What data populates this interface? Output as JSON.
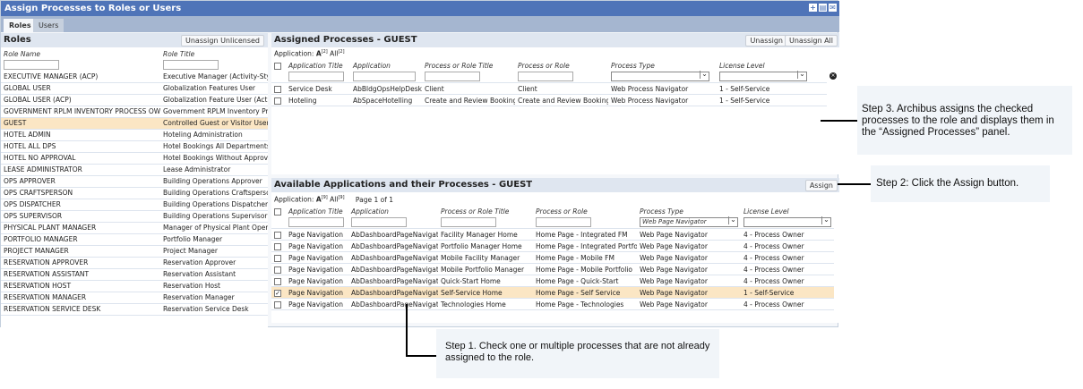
{
  "title": "Assign Processes to Roles or Users",
  "title_icons": [
    "add-icon",
    "print-icon",
    "email-icon"
  ],
  "tabs": [
    {
      "label": "Roles",
      "active": true
    },
    {
      "label": "Users",
      "active": false
    }
  ],
  "roles": {
    "title": "Roles",
    "unassign_unlicensed": "Unassign Unlicensed",
    "columns": [
      "Role Name",
      "Role Title"
    ],
    "rows": [
      [
        "EXECUTIVE MANAGER (ACP)",
        "Executive Manager (Activity-Style"
      ],
      [
        "GLOBAL USER",
        "Globalization Features User"
      ],
      [
        "GLOBAL USER (ACP)",
        "Globalization Feature User (Activit"
      ],
      [
        "GOVERNMENT RPLM INVENTORY PROCESS OWNER",
        "Government RPLM Inventory Proce"
      ],
      [
        "GUEST",
        "Controlled Guest or Visitor Users"
      ],
      [
        "HOTEL ADMIN",
        "Hoteling Administration"
      ],
      [
        "HOTEL ALL DPS",
        "Hotel Bookings All Departments"
      ],
      [
        "HOTEL NO APPROVAL",
        "Hotel Bookings Without Approval"
      ],
      [
        "LEASE ADMINISTRATOR",
        "Lease Administrator"
      ],
      [
        "OPS APPROVER",
        "Building Operations Approver"
      ],
      [
        "OPS CRAFTSPERSON",
        "Building Operations Craftsperson"
      ],
      [
        "OPS DISPATCHER",
        "Building Operations Dispatcher"
      ],
      [
        "OPS SUPERVISOR",
        "Building Operations Supervisor"
      ],
      [
        "PHYSICAL PLANT MANAGER",
        "Manager of Physical Plant Operati"
      ],
      [
        "PORTFOLIO MANAGER",
        "Portfolio Manager"
      ],
      [
        "PROJECT MANAGER",
        "Project Manager"
      ],
      [
        "RESERVATION APPROVER",
        "Reservation Approver"
      ],
      [
        "RESERVATION ASSISTANT",
        "Reservation Assistant"
      ],
      [
        "RESERVATION HOST",
        "Reservation Host"
      ],
      [
        "RESERVATION MANAGER",
        "Reservation Manager"
      ],
      [
        "RESERVATION SERVICE DESK",
        "Reservation Service Desk"
      ]
    ],
    "selected_index": 4
  },
  "assigned": {
    "title": "Assigned Processes - GUEST",
    "unassign": "Unassign",
    "unassign_all": "Unassign All",
    "app_label": "Application:",
    "filter_a": "A",
    "filter_a_count": "[2]",
    "filter_all": "All",
    "filter_all_count": "[2]",
    "columns": [
      "Application Title",
      "Application",
      "Process or Role Title",
      "Process or Role",
      "Process Type",
      "License Level"
    ],
    "rows": [
      [
        "Service Desk",
        "AbBldgOpsHelpDesk",
        "Client",
        "Client",
        "Web Process Navigator",
        "1 - Self-Service"
      ],
      [
        "Hoteling",
        "AbSpaceHotelling",
        "Create and Review Bookings",
        "Create and Review Bookings",
        "Web Process Navigator",
        "1 - Self-Service"
      ]
    ]
  },
  "available": {
    "title": "Available Applications and their Processes - GUEST",
    "assign": "Assign",
    "app_label": "Application:",
    "filter_a": "A",
    "filter_a_count": "[9]",
    "filter_all": "All",
    "filter_all_count": "[9]",
    "page": "Page 1 of 1",
    "columns": [
      "Application Title",
      "Application",
      "Process or Role Title",
      "Process or Role",
      "Process Type",
      "License Level"
    ],
    "process_type_filter": "Web Page Navigator",
    "rows": [
      {
        "cells": [
          "Page Navigation",
          "AbDashboardPageNavigation",
          "Facility Manager Home",
          "Home Page - Integrated FM",
          "Web Page Navigator",
          "4 - Process Owner"
        ],
        "checked": false
      },
      {
        "cells": [
          "Page Navigation",
          "AbDashboardPageNavigation",
          "Portfolio Manager Home",
          "Home Page - Integrated Portfolio",
          "Web Page Navigator",
          "4 - Process Owner"
        ],
        "checked": false
      },
      {
        "cells": [
          "Page Navigation",
          "AbDashboardPageNavigation",
          "Mobile Facility Manager",
          "Home Page - Mobile FM",
          "Web Page Navigator",
          "4 - Process Owner"
        ],
        "checked": false
      },
      {
        "cells": [
          "Page Navigation",
          "AbDashboardPageNavigation",
          "Mobile Portfolio Manager",
          "Home Page - Mobile Portfolio",
          "Web Page Navigator",
          "4 - Process Owner"
        ],
        "checked": false
      },
      {
        "cells": [
          "Page Navigation",
          "AbDashboardPageNavigation",
          "Quick-Start Home",
          "Home Page - Quick-Start",
          "Web Page Navigator",
          "4 - Process Owner"
        ],
        "checked": false
      },
      {
        "cells": [
          "Page Navigation",
          "AbDashboardPageNavigation",
          "Self-Service Home",
          "Home Page - Self Service",
          "Web Page Navigator",
          "1 - Self-Service"
        ],
        "checked": true
      },
      {
        "cells": [
          "Page Navigation",
          "AbDashboardPageNavigation",
          "Technologies Home",
          "Home Page - Technologies",
          "Web Page Navigator",
          "4 - Process Owner"
        ],
        "checked": false
      }
    ]
  },
  "notes": {
    "step3": "Step 3. Archibus assigns the checked processes to the role and displays them in the “Assigned Processes” panel.",
    "step2": "Step 2:  Click the Assign button.",
    "step1": "Step 1. Check one or multiple processes that are not already assigned to the role."
  }
}
